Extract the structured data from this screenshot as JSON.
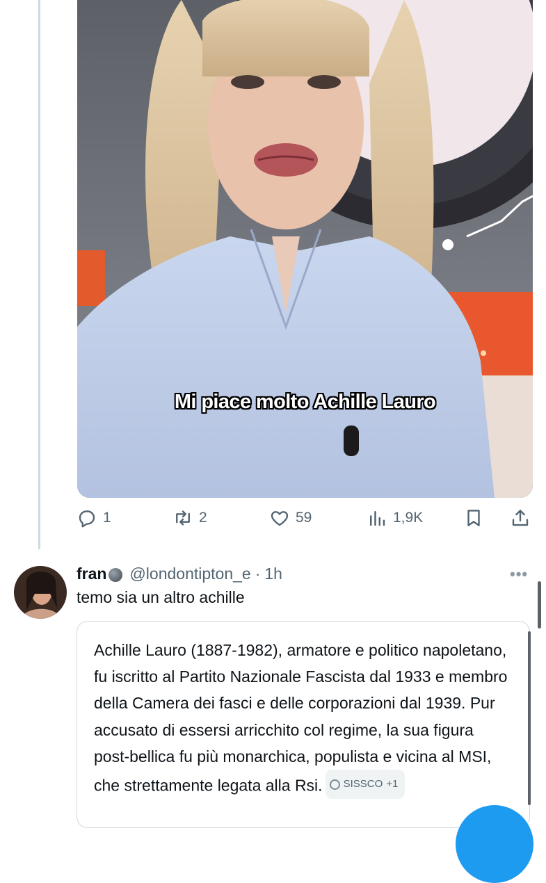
{
  "video": {
    "subtitle": "Mi piace molto Achille Lauro"
  },
  "actions": {
    "replies": "1",
    "retweets": "2",
    "likes": "59",
    "views": "1,9K"
  },
  "icons": {
    "reply": "reply-icon",
    "retweet": "retweet-icon",
    "like": "heart-icon",
    "views": "views-icon",
    "bookmark": "bookmark-icon",
    "share": "share-icon",
    "more": "more-icon",
    "globe": "globe-icon",
    "moon": "moon-emoji-icon"
  },
  "reply": {
    "display_name": "fran",
    "handle": "@londontipton_e",
    "separator": "·",
    "time": "1h",
    "text": "temo sia un altro achille",
    "more": "•••"
  },
  "note": {
    "text": "Achille Lauro (1887-1982), armatore e politico napoletano, fu iscritto al Partito Nazionale Fascista dal 1933 e membro della Camera dei fasci e delle corporazioni dal 1939. Pur accusato di essersi arricchito col regime, la sua figura post-bellica fu più monarchica, populista e vicina al MSI, che strettamente legata alla Rsi.",
    "source": "SISSCO",
    "source_extra": "+1"
  },
  "colors": {
    "accent": "#1d9bf0",
    "text": "#0f1419",
    "muted": "#536471",
    "border": "#cfd9de"
  }
}
